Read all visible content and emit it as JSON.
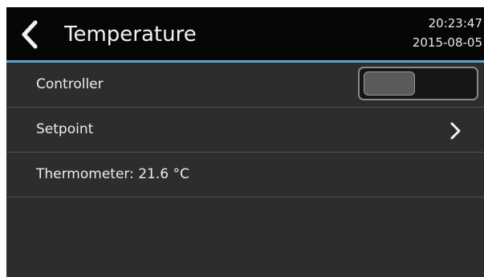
{
  "header": {
    "title": "Temperature",
    "time": "20:23:47",
    "date": "2015-08-05",
    "back_icon": "chevron-left-icon"
  },
  "rows": [
    {
      "label": "Controller",
      "control": "toggle",
      "toggle_on": false
    },
    {
      "label": "Setpoint",
      "control": "chevron-right-icon"
    },
    {
      "label": "Thermometer: 21.6 °C"
    }
  ],
  "colors": {
    "header_bg": "#060606",
    "accent_line": "#5aa8d2",
    "screen_bg": "#2d2d2d",
    "text": "#ececec"
  }
}
